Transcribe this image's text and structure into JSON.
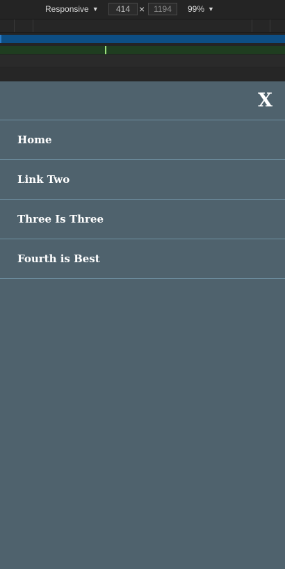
{
  "devtools": {
    "device": "Responsive",
    "width": "414",
    "times": "×",
    "height": "1194",
    "zoom": "99%",
    "caret_icon": "▼"
  },
  "colors": {
    "menu_bg": "#4f626d",
    "divider": "#6e8fa0",
    "media_bar_blue": "#0d4e84",
    "media_bar_green": "#1f3d20"
  },
  "menu": {
    "close_label": "X",
    "items": [
      {
        "label": "Home"
      },
      {
        "label": "Link Two"
      },
      {
        "label": "Three Is Three"
      },
      {
        "label": "Fourth is Best"
      }
    ]
  }
}
